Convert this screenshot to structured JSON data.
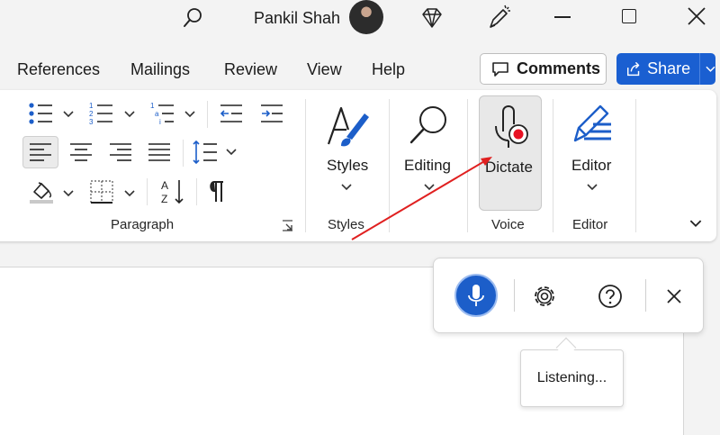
{
  "titlebar": {
    "user_name": "Pankil Shah"
  },
  "tabs": [
    "References",
    "Mailings",
    "Review",
    "View",
    "Help"
  ],
  "toolbar": {
    "comments_label": "Comments",
    "share_label": "Share"
  },
  "ribbon": {
    "groups": {
      "paragraph": "Paragraph",
      "styles": "Styles",
      "voice": "Voice",
      "editor": "Editor"
    },
    "buttons": {
      "styles": "Styles",
      "editing": "Editing",
      "dictate": "Dictate",
      "editor": "Editor"
    }
  },
  "dictation": {
    "status": "Listening..."
  },
  "colors": {
    "accent": "#1a5fd1",
    "mic": "#1c5ec9",
    "record": "#e81123",
    "annotation": "#e02020"
  }
}
